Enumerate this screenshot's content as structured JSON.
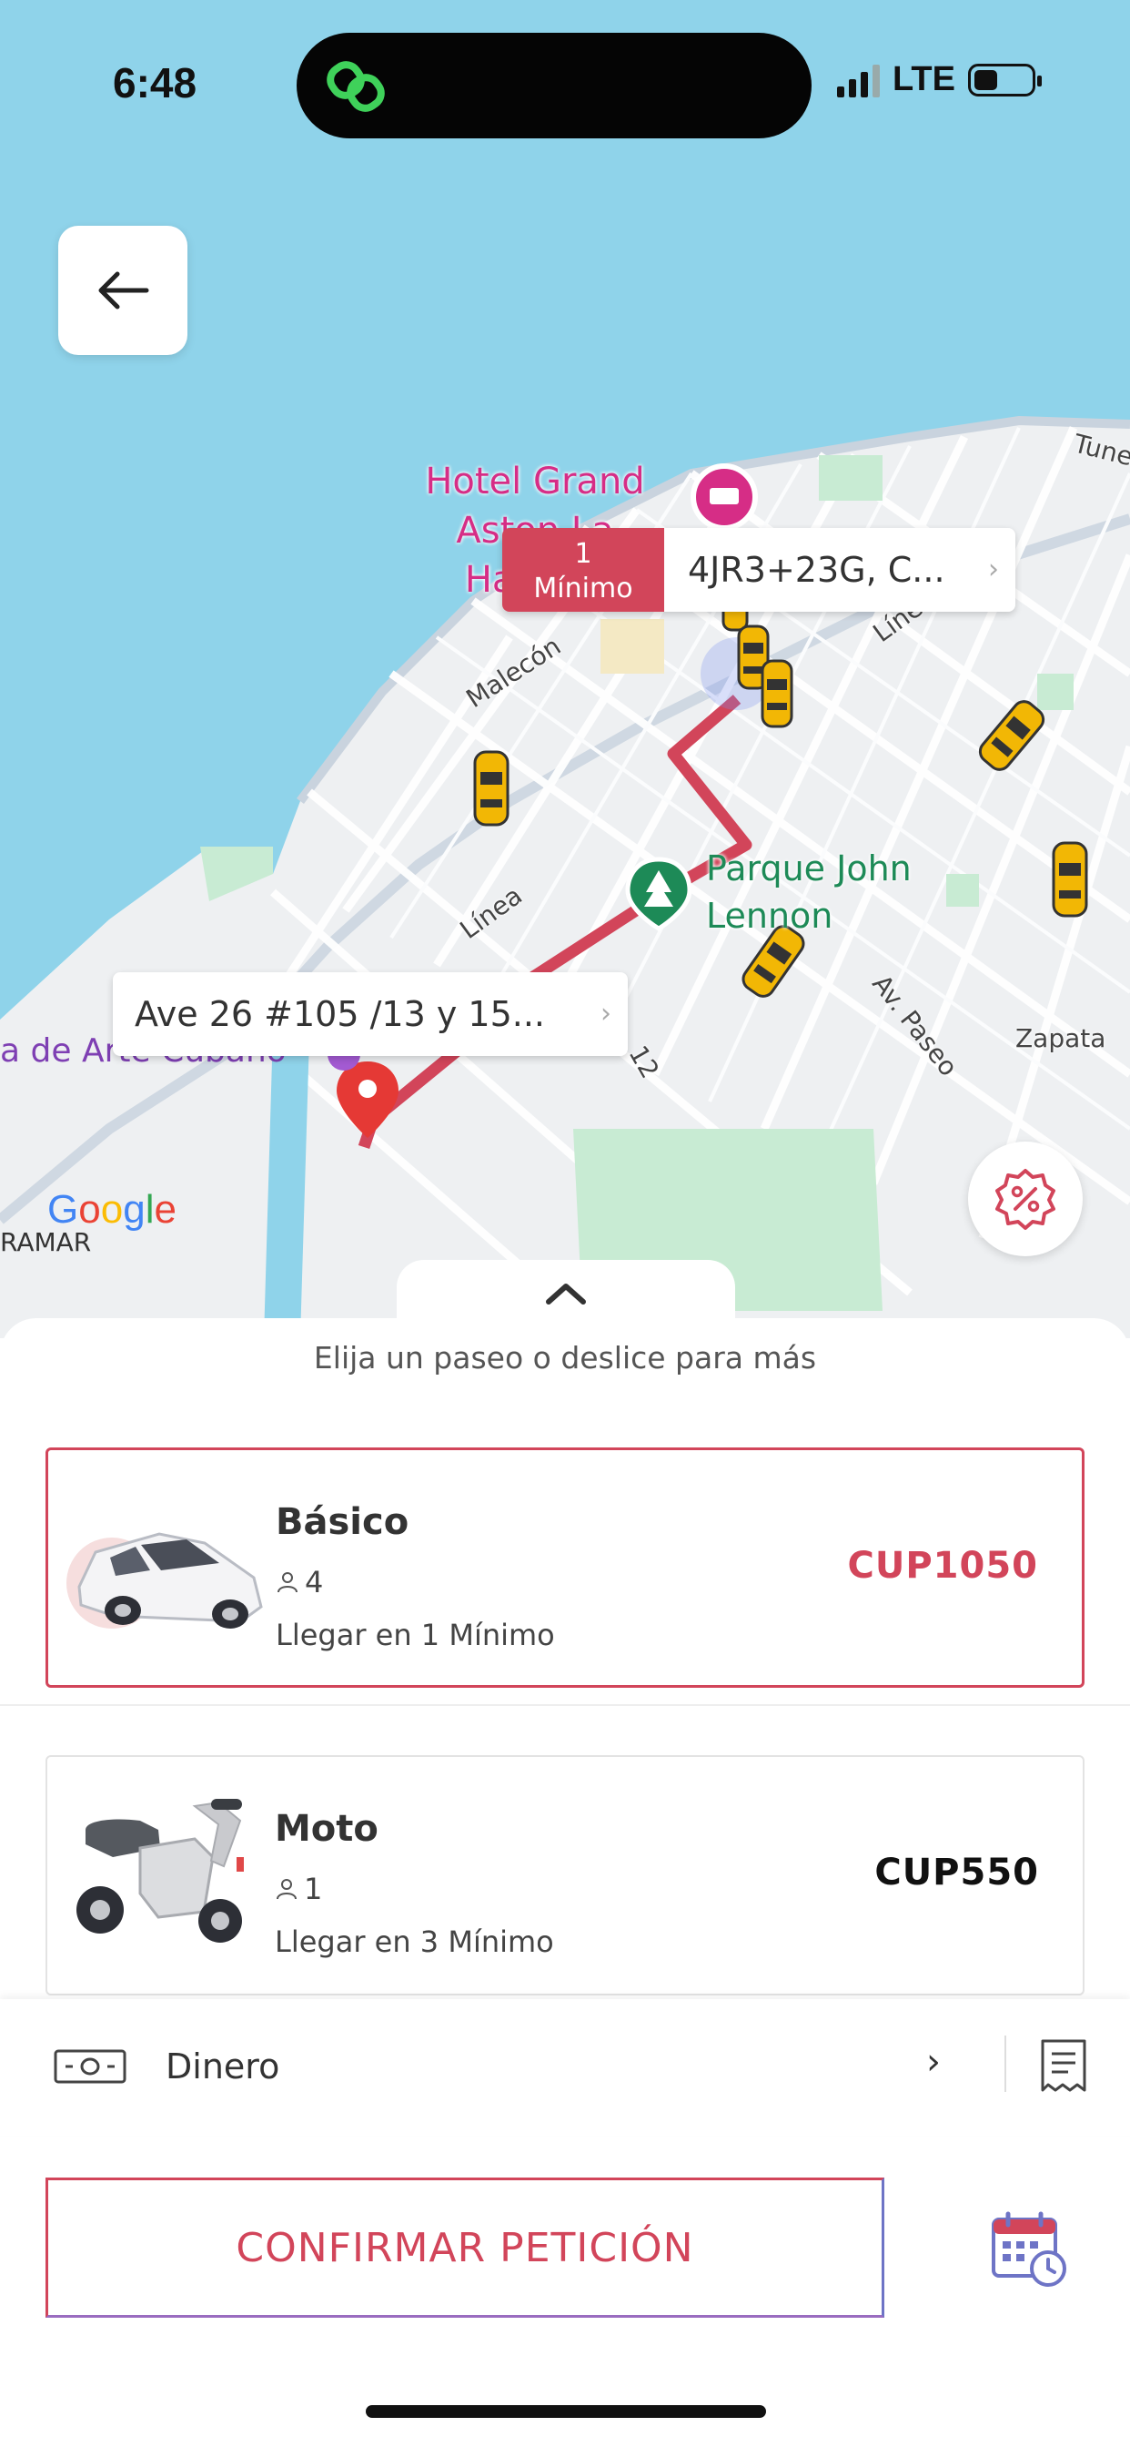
{
  "status_bar": {
    "time": "6:48",
    "network": "LTE"
  },
  "map": {
    "hotel_label": "Hotel Grand Aston La Habana",
    "park_label": "Parque John Lennon",
    "streets": [
      "Malecón",
      "Línea",
      "Línea",
      "Av. Paseo",
      "Zapata",
      "12",
      "Tune"
    ],
    "poi_left": "a de Arte Cubano",
    "area_label": "RAMAR",
    "google_letters": [
      "G",
      "o",
      "o",
      "g",
      "l",
      "e"
    ],
    "colors": {
      "water": "#8fd3ea",
      "land": "#eef0f2",
      "route": "#d2455a",
      "park": "#c8ebd3"
    }
  },
  "destination": {
    "eta_value": "1",
    "eta_unit": "Mínimo",
    "address": "4JR3+23G, C..."
  },
  "origin": {
    "address": "Ave 26 #105 /13 y 15..."
  },
  "sheet": {
    "hint": "Elija un paseo o deslice para más",
    "rides": [
      {
        "name": "Básico",
        "seats": "4",
        "eta": "Llegar en 1 Mínimo",
        "price": "CUP1050",
        "selected": true
      },
      {
        "name": "Moto",
        "seats": "1",
        "eta": "Llegar en 3 Mínimo",
        "price": "CUP550",
        "selected": false
      }
    ]
  },
  "payment": {
    "method": "Dinero"
  },
  "confirm": {
    "label": "CONFIRMAR PETICIÓN"
  },
  "colors": {
    "accent": "#d2455a",
    "accent_secondary": "#6e74c6"
  }
}
